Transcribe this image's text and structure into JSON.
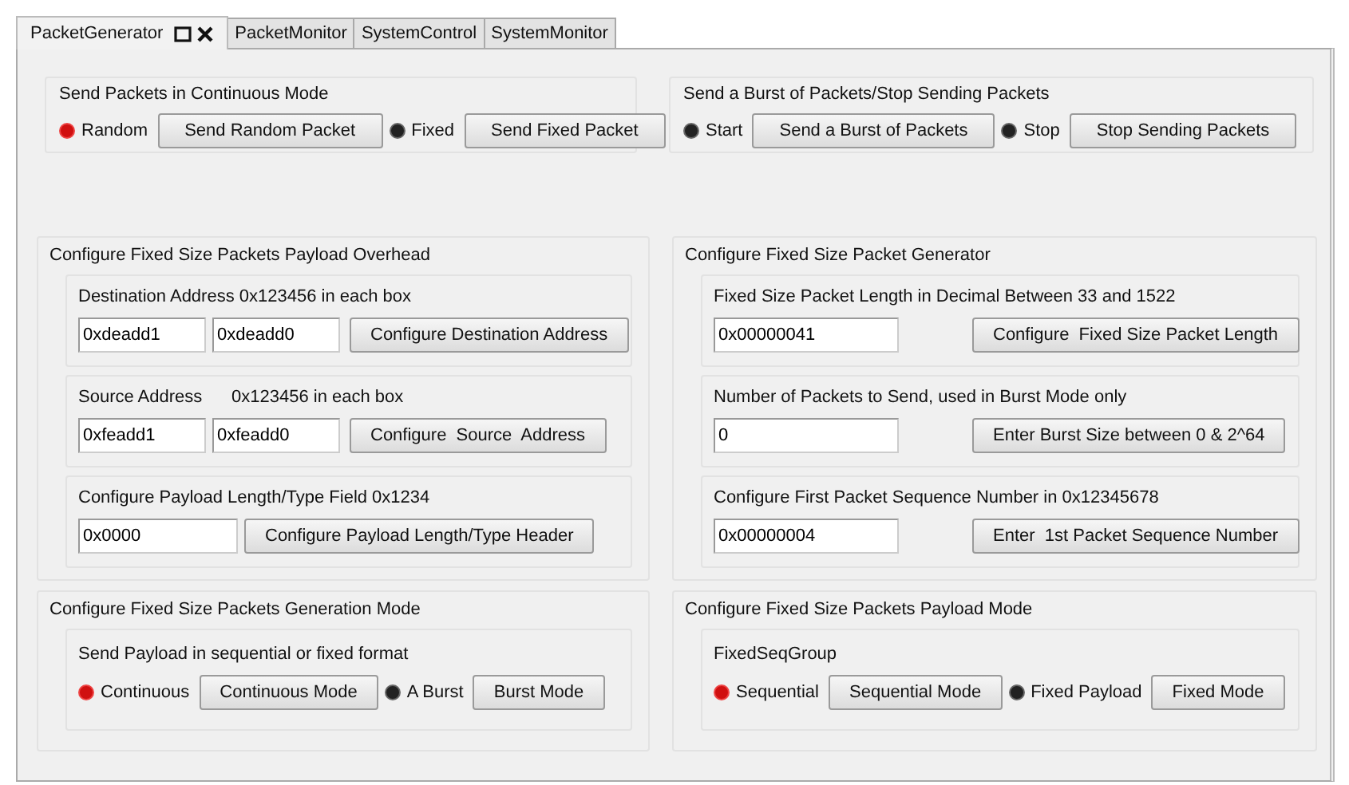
{
  "tabs": [
    {
      "label": "PacketGenerator",
      "selected": true,
      "closable": true
    },
    {
      "label": "PacketMonitor",
      "selected": false,
      "closable": false
    },
    {
      "label": "SystemControl",
      "selected": false,
      "closable": false
    },
    {
      "label": "SystemMonitor",
      "selected": false,
      "closable": false
    }
  ],
  "rows": [
    {
      "kind": "top",
      "groups": [
        {
          "title": "Send Packets in Continuous Mode",
          "controls": [
            {
              "kind": "indicator",
              "label": "Random",
              "on": true
            },
            {
              "kind": "button",
              "label": "Send Random Packet"
            },
            {
              "kind": "indicator",
              "label": "Fixed",
              "on": false
            },
            {
              "kind": "button",
              "label": "Send Fixed Packet"
            }
          ]
        },
        {
          "title": "Send a Burst of Packets/Stop Sending Packets",
          "controls": [
            {
              "kind": "indicator",
              "label": "Start",
              "on": false
            },
            {
              "kind": "button",
              "label": "Send a Burst of Packets"
            },
            {
              "kind": "indicator",
              "label": "Stop",
              "on": false
            },
            {
              "kind": "button",
              "label": "Stop Sending Packets"
            }
          ]
        }
      ]
    },
    {
      "kind": "middle",
      "groups": [
        {
          "title": "Configure Fixed Size Packets Payload Overhead",
          "subgroups": [
            {
              "title": "Destination Address 0x123456 in each box",
              "controls": [
                {
                  "kind": "field",
                  "value": "0xdeadd1"
                },
                {
                  "kind": "field",
                  "value": "0xdeadd0"
                },
                {
                  "kind": "button",
                  "label": "Configure Destination Address"
                }
              ]
            },
            {
              "title": "Source Address      0x123456 in each box",
              "controls": [
                {
                  "kind": "field",
                  "value": "0xfeadd1"
                },
                {
                  "kind": "field",
                  "value": "0xfeadd0"
                },
                {
                  "kind": "button",
                  "label": "Configure  Source  Address"
                }
              ]
            },
            {
              "title": "Configure Payload Length/Type Field 0x1234",
              "controls": [
                {
                  "kind": "field",
                  "value": "0x0000"
                },
                {
                  "kind": "button",
                  "label": "Configure Payload Length/Type Header"
                }
              ]
            }
          ]
        },
        {
          "title": "Configure Fixed Size Packet Generator",
          "subgroups": [
            {
              "title": "Fixed Size Packet Length in Decimal Between 33 and 1522",
              "controls": [
                {
                  "kind": "field",
                  "value": "0x00000041"
                },
                {
                  "kind": "button",
                  "label": "Configure  Fixed Size Packet Length"
                }
              ]
            },
            {
              "title": "Number of Packets to Send, used in Burst Mode only",
              "controls": [
                {
                  "kind": "field",
                  "value": "0"
                },
                {
                  "kind": "button",
                  "label": "Enter Burst Size between 0 & 2^64"
                }
              ]
            },
            {
              "title": "Configure First Packet Sequence Number in 0x12345678",
              "controls": [
                {
                  "kind": "field",
                  "value": "0x00000004"
                },
                {
                  "kind": "button",
                  "label": "Enter  1st Packet Sequence Number"
                }
              ]
            }
          ]
        }
      ]
    },
    {
      "kind": "bottom",
      "groups": [
        {
          "title": "Configure Fixed Size Packets Generation Mode",
          "subgroups": [
            {
              "title": "Send Payload in sequential or fixed format",
              "controls": [
                {
                  "kind": "indicator",
                  "label": "Continuous",
                  "on": true
                },
                {
                  "kind": "button",
                  "label": "Continuous Mode"
                },
                {
                  "kind": "indicator",
                  "label": "A Burst",
                  "on": false
                },
                {
                  "kind": "button",
                  "label": "Burst Mode"
                }
              ]
            }
          ]
        },
        {
          "title": "Configure Fixed Size Packets Payload Mode",
          "subgroups": [
            {
              "title": "FixedSeqGroup",
              "controls": [
                {
                  "kind": "indicator",
                  "label": "Sequential",
                  "on": true
                },
                {
                  "kind": "button",
                  "label": "Sequential Mode"
                },
                {
                  "kind": "indicator",
                  "label": "Fixed Payload",
                  "on": false
                },
                {
                  "kind": "button",
                  "label": "Fixed Mode"
                }
              ]
            }
          ]
        }
      ]
    }
  ]
}
